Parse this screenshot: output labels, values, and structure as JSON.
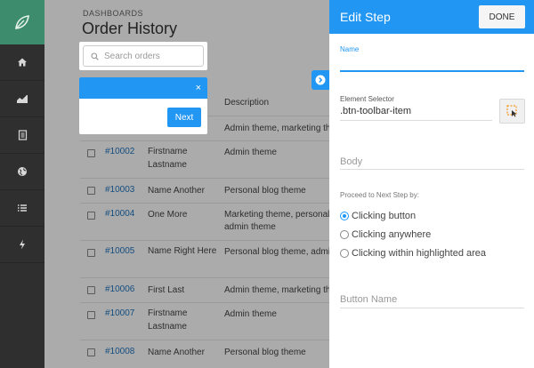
{
  "main": {
    "breadcrumb": "DASHBOARDS",
    "title": "Order History",
    "search": {
      "placeholder": "Search orders"
    },
    "table": {
      "columns": {
        "description": "Description"
      },
      "rows": [
        {
          "order": "",
          "customer": "",
          "description": "Admin theme, marketing theme"
        },
        {
          "order": "#10002",
          "customer": "Firstname Lastname",
          "description": "Admin theme"
        },
        {
          "order": "#10003",
          "customer": "Name Another",
          "description": "Personal blog theme"
        },
        {
          "order": "#10004",
          "customer": "One More",
          "description": "Marketing theme, personal admin theme"
        },
        {
          "order": "#10005",
          "customer": "Name Right Here",
          "description": "Personal blog theme, admin theme"
        },
        {
          "order": "#10006",
          "customer": "First Last",
          "description": "Admin theme, marketing theme"
        },
        {
          "order": "#10007",
          "customer": "Firstname Lastname",
          "description": "Admin theme"
        },
        {
          "order": "#10008",
          "customer": "Name Another",
          "description": "Personal blog theme"
        }
      ]
    }
  },
  "tooltip": {
    "close": "×",
    "next": "Next"
  },
  "panel": {
    "title": "Edit Step",
    "done": "DONE",
    "name_label": "Name",
    "name_value": "",
    "selector_label": "Element Selector",
    "selector_value": ".btn-toolbar-item",
    "body_placeholder": "Body",
    "proceed_label": "Proceed to Next Step by:",
    "options": [
      {
        "label": "Clicking button",
        "selected": true
      },
      {
        "label": "Clicking anywhere",
        "selected": false
      },
      {
        "label": "Clicking within highlighted area",
        "selected": false
      }
    ],
    "button_name_placeholder": "Button Name"
  },
  "sidebar": {
    "icons": [
      "leaf-icon",
      "home-icon",
      "area-chart-icon",
      "document-icon",
      "globe-icon",
      "list-icon",
      "bolt-icon"
    ]
  },
  "colors": {
    "accent": "#2196f3",
    "brand": "#3e8c6e",
    "sidebar": "#2f2f2f",
    "link": "#1e73be"
  }
}
